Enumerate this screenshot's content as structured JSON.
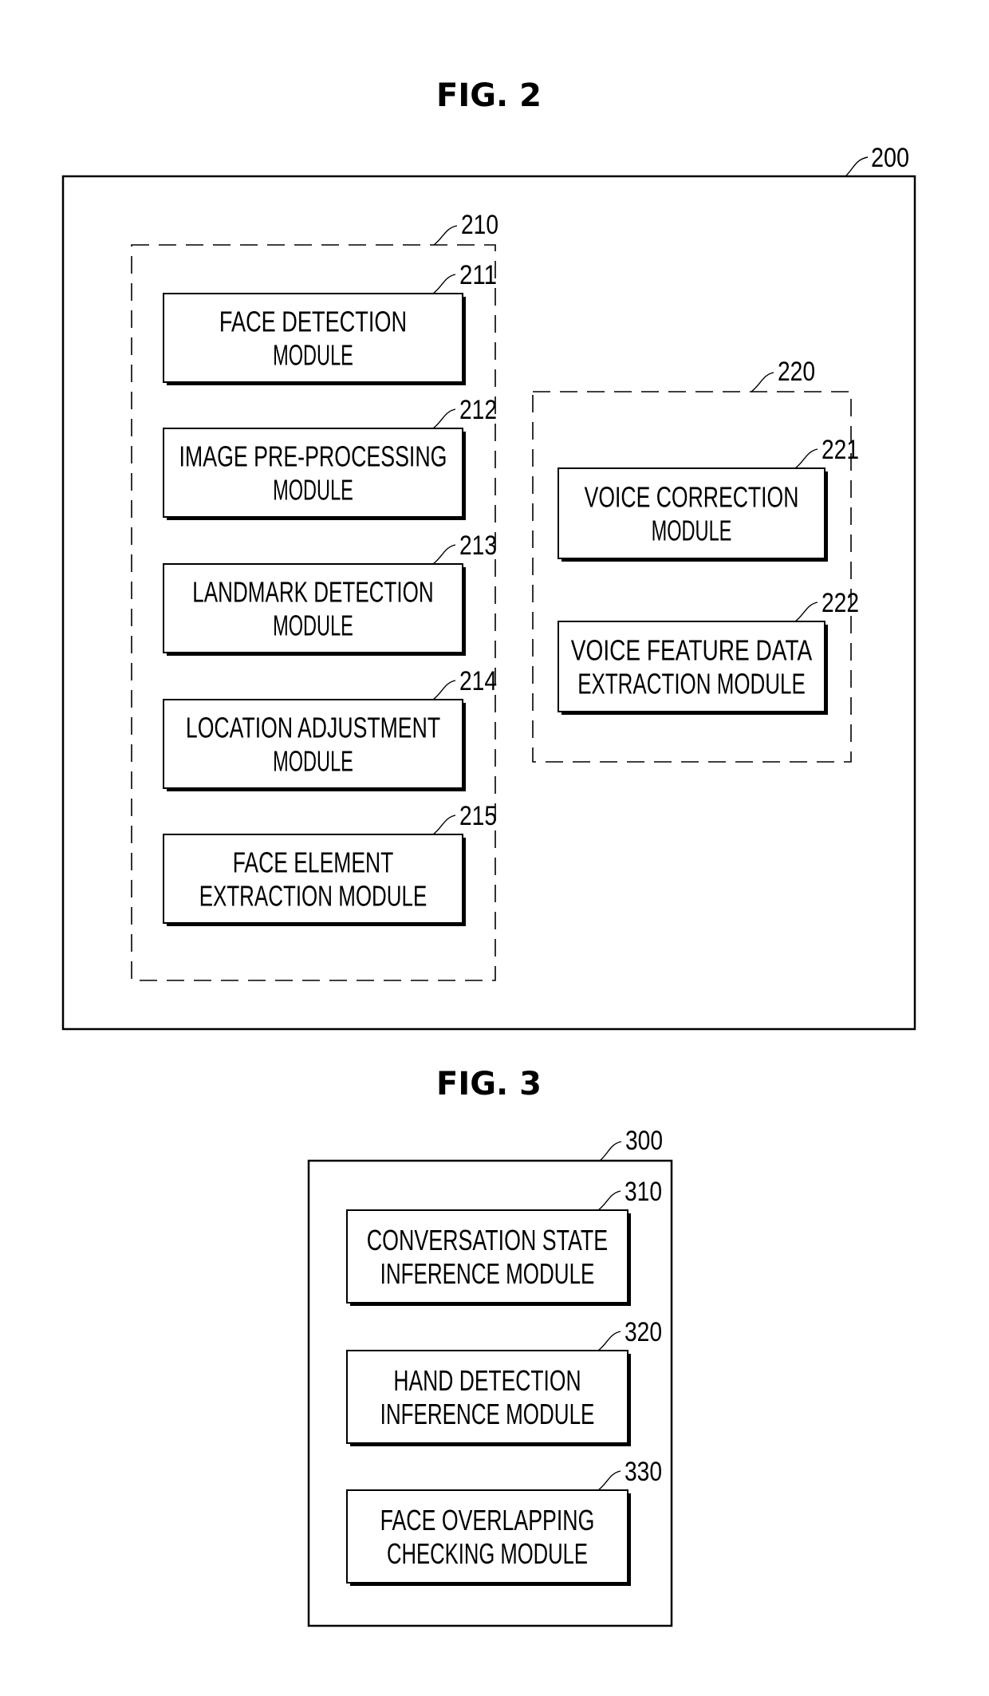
{
  "figures": [
    {
      "id": "fig2",
      "title": "FIG. 2",
      "container": {
        "ref": "200"
      },
      "groups": [
        {
          "id": "g210",
          "ref": "210",
          "modules": [
            {
              "ref": "211",
              "lines": [
                "FACE DETECTION",
                "MODULE"
              ]
            },
            {
              "ref": "212",
              "lines": [
                "IMAGE PRE-PROCESSING",
                "MODULE"
              ]
            },
            {
              "ref": "213",
              "lines": [
                "LANDMARK DETECTION",
                "MODULE"
              ]
            },
            {
              "ref": "214",
              "lines": [
                "LOCATION ADJUSTMENT",
                "MODULE"
              ]
            },
            {
              "ref": "215",
              "lines": [
                "FACE ELEMENT",
                "EXTRACTION MODULE"
              ]
            }
          ]
        },
        {
          "id": "g220",
          "ref": "220",
          "modules": [
            {
              "ref": "221",
              "lines": [
                "VOICE CORRECTION",
                "MODULE"
              ]
            },
            {
              "ref": "222",
              "lines": [
                "VOICE FEATURE DATA",
                "EXTRACTION MODULE"
              ]
            }
          ]
        }
      ]
    },
    {
      "id": "fig3",
      "title": "FIG. 3",
      "container": {
        "ref": "300"
      },
      "modules": [
        {
          "ref": "310",
          "lines": [
            "CONVERSATION STATE",
            "INFERENCE MODULE"
          ]
        },
        {
          "ref": "320",
          "lines": [
            "HAND DETECTION",
            "INFERENCE MODULE"
          ]
        },
        {
          "ref": "330",
          "lines": [
            "FACE OVERLAPPING",
            "CHECKING MODULE"
          ]
        }
      ]
    }
  ]
}
